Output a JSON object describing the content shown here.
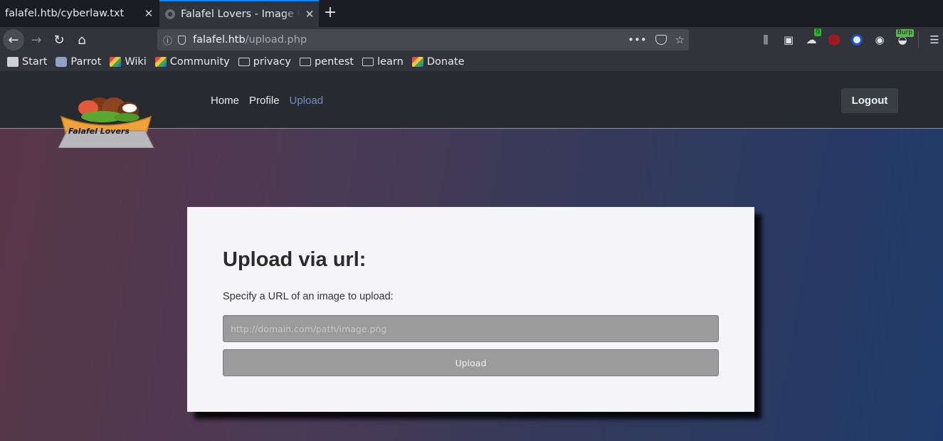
{
  "browser": {
    "tabs": [
      {
        "title": "falafel.htb/cyberlaw.txt",
        "active": false
      },
      {
        "title": "Falafel Lovers - Image Upload",
        "active": true
      }
    ],
    "url": {
      "domain": "falafel.htb",
      "path": "/upload.php"
    },
    "bookmarks": [
      {
        "label": "Start",
        "icon": "star-icon"
      },
      {
        "label": "Parrot",
        "icon": "parrot-icon"
      },
      {
        "label": "Wiki",
        "icon": "colorful-icon"
      },
      {
        "label": "Community",
        "icon": "colorful-icon"
      },
      {
        "label": "privacy",
        "icon": "folder-icon"
      },
      {
        "label": "pentest",
        "icon": "folder-icon"
      },
      {
        "label": "learn",
        "icon": "folder-icon"
      },
      {
        "label": "Donate",
        "icon": "colorful-icon"
      }
    ],
    "extensions": {
      "badge_count": "0",
      "burp_label": "Burp"
    }
  },
  "site": {
    "logo_text": "Falafel Lovers",
    "nav": [
      {
        "label": "Home",
        "active": false
      },
      {
        "label": "Profile",
        "active": false
      },
      {
        "label": "Upload",
        "active": true
      }
    ],
    "logout_label": "Logout"
  },
  "upload": {
    "heading": "Upload via url:",
    "description": "Specify a URL of an image to upload:",
    "input_placeholder": "http://domain.com/path/image.png",
    "button_label": "Upload"
  },
  "colors": {
    "accent": "#0a84ff",
    "nav_active": "#6f8fc5",
    "header_bg": "#272b30"
  }
}
